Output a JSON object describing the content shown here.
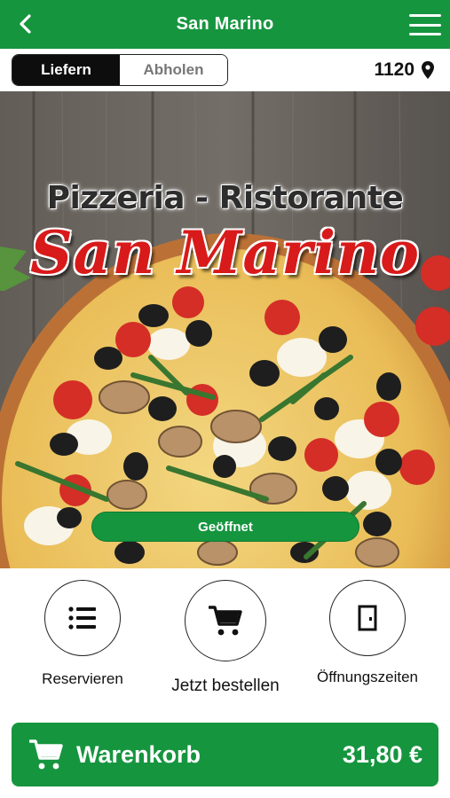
{
  "header": {
    "title": "San Marino",
    "back_icon": "chevron-left-icon",
    "menu_icon": "hamburger-menu-icon"
  },
  "order_mode": {
    "options": [
      "Liefern",
      "Abholen"
    ],
    "selected": "Liefern"
  },
  "location": {
    "zip": "1120",
    "icon": "map-pin-icon"
  },
  "hero": {
    "subtitle": "Pizzeria - Ristorante",
    "brand": "San Marino",
    "status_label": "Geöffnet"
  },
  "actions": [
    {
      "label": "Reservieren",
      "icon": "list-icon"
    },
    {
      "label": "Jetzt bestellen",
      "icon": "shopping-cart-icon"
    },
    {
      "label": "Öffnungszeiten",
      "icon": "door-icon"
    }
  ],
  "cart": {
    "label": "Warenkorb",
    "total": "31,80 €",
    "icon": "shopping-cart-icon"
  },
  "colors": {
    "brand_green": "#16953f",
    "segment_active": "#0d0d0d",
    "logo_red": "#d81a1a"
  }
}
